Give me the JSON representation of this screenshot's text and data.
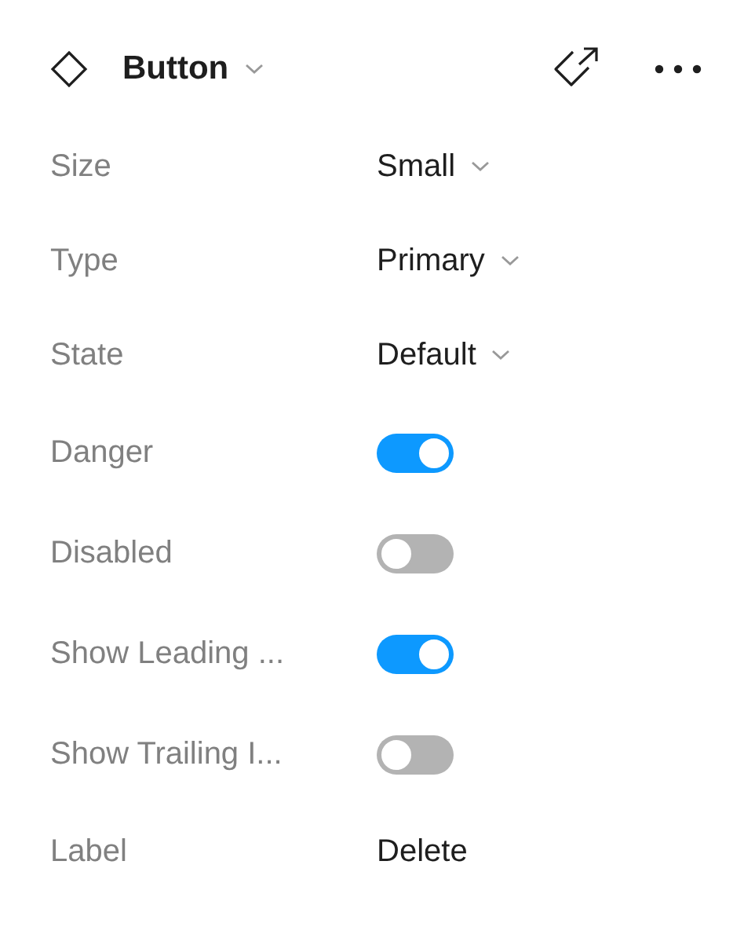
{
  "header": {
    "title": "Button"
  },
  "properties": [
    {
      "kind": "dropdown",
      "label": "Size",
      "value": "Small"
    },
    {
      "kind": "dropdown",
      "label": "Type",
      "value": "Primary"
    },
    {
      "kind": "dropdown",
      "label": "State",
      "value": "Default"
    },
    {
      "kind": "toggle",
      "label": "Danger",
      "on": true
    },
    {
      "kind": "toggle",
      "label": "Disabled",
      "on": false
    },
    {
      "kind": "toggle",
      "label": "Show Leading ...",
      "on": true
    },
    {
      "kind": "toggle",
      "label": "Show Trailing I...",
      "on": false
    },
    {
      "kind": "text",
      "label": "Label",
      "value": "Delete"
    }
  ]
}
